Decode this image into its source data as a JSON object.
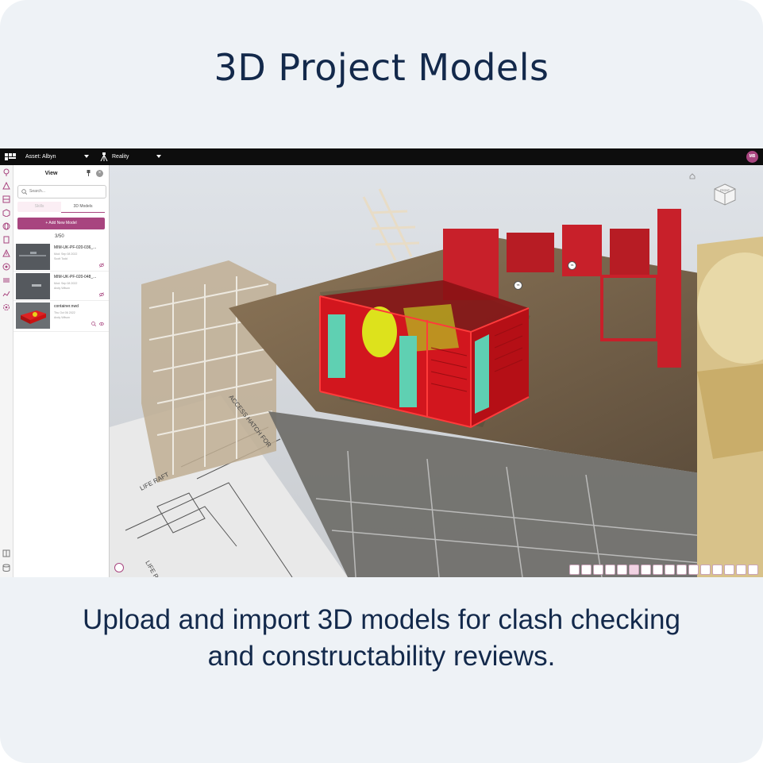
{
  "headline": "3D Project Models",
  "caption": {
    "line1": "Upload and import 3D models for clash checking",
    "line2": "and constructability reviews."
  },
  "colors": {
    "card_bg": "#eef2f6",
    "text_navy": "#13294b",
    "accent": "#a8457f",
    "topbar": "#0d0d0d"
  },
  "app": {
    "topbar": {
      "asset_label": "Asset: Albyn",
      "reality_label": "Reality",
      "avatar_initials": "MB"
    },
    "rail_icons": [
      "map-pin-icon",
      "layers-icon",
      "image-icon",
      "cube-icon",
      "globe-icon",
      "building-icon",
      "warning-icon",
      "radar-icon",
      "menu-icon",
      "chart-icon",
      "gear-icon",
      "expand-icon",
      "database-icon"
    ],
    "panel": {
      "title": "View",
      "search_placeholder": "Search...",
      "tabs": [
        {
          "label": "Skills",
          "active": false
        },
        {
          "label": "3D Models",
          "active": true
        }
      ],
      "add_button_label": "+ Add New Model",
      "count": "3/50",
      "models": [
        {
          "name": "MIM-UK-PF-020-036_...",
          "date": "Mod: Sep 08 2022",
          "author": "Scott Todd"
        },
        {
          "name": "MIM-UK-PF-020-048_...",
          "date": "Mod: Sep 08 2022",
          "author": "Andy Wilson"
        },
        {
          "name": "container.nwd",
          "date": "Thu Oct 06 2022",
          "author": "Andy Wilson"
        }
      ]
    },
    "viewport": {
      "nav_cube_label": "FRONT",
      "markers": [
        "TB",
        "TB"
      ],
      "drawing_labels": [
        "ACCESS HATCH FOR",
        "LIFE RAFT",
        "LIFE RAFT"
      ],
      "toolbar_icons": [
        "measure-icon",
        "section-icon",
        "pin-icon",
        "markup-icon",
        "pencil-icon",
        "highlight-icon",
        "view-icon",
        "tree-icon",
        "camera-icon",
        "layers-icon",
        "crop-icon",
        "scissors-icon",
        "flag-icon",
        "share-icon",
        "stack-icon",
        "fullscreen-icon"
      ]
    }
  }
}
